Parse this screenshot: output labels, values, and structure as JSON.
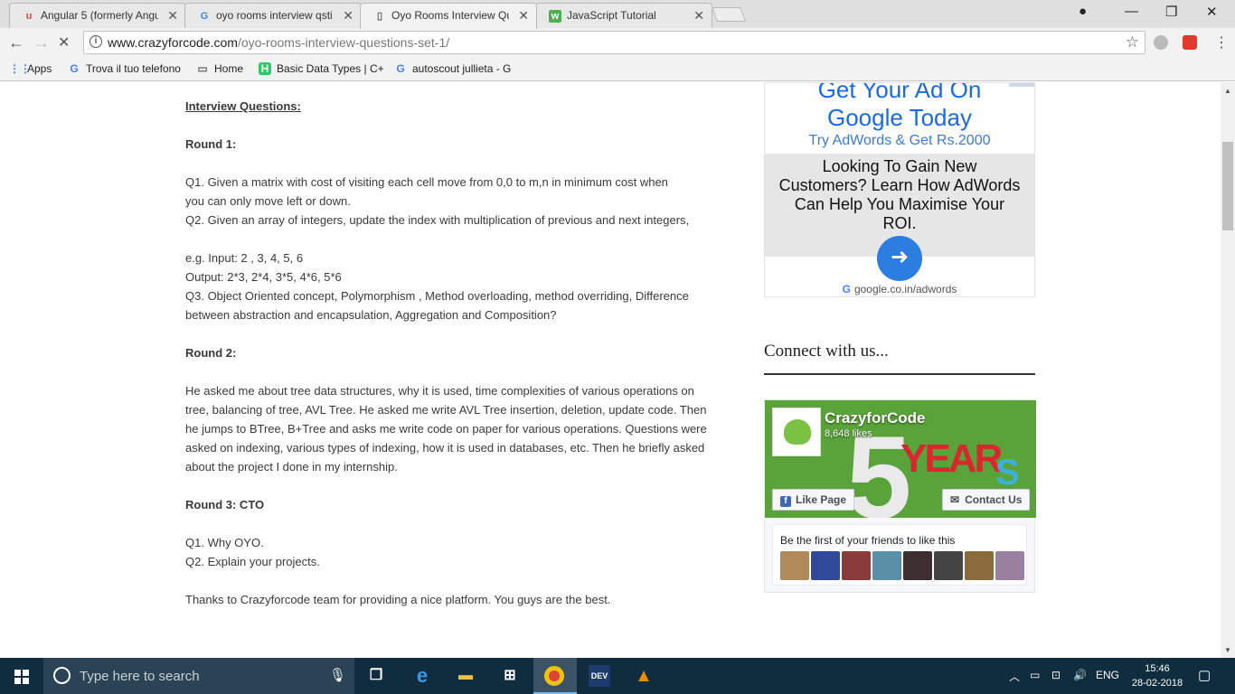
{
  "browser": {
    "tabs": [
      {
        "title": "Angular 5 (formerly Angu",
        "icon": "udemy-icon",
        "color": "#e0493f"
      },
      {
        "title": "oyo rooms interview qsti",
        "icon": "google-icon",
        "color": "#4285f4"
      },
      {
        "title": "Oyo Rooms Interview Qu",
        "icon": "page-icon",
        "color": "#666666"
      },
      {
        "title": "JavaScript Tutorial",
        "icon": "w3schools-icon",
        "color": "#4caf50"
      }
    ],
    "url_host": "www.crazyforcode.com",
    "url_path": "/oyo-rooms-interview-questions-set-1/",
    "bookmarks": [
      {
        "label": "Apps",
        "icon": "apps-grid-icon"
      },
      {
        "label": "Trova il tuo telefono",
        "icon": "google-icon"
      },
      {
        "label": "Home",
        "icon": "page-icon"
      },
      {
        "label": "Basic Data Types | C+",
        "icon": "hackerrank-icon"
      },
      {
        "label": "autoscout jullieta - G",
        "icon": "google-icon"
      }
    ]
  },
  "article": {
    "heading": "Interview Questions:",
    "round1_title": "Round 1:",
    "r1_q1_line1": "Q1. Given a matrix with cost of visiting each cell move from 0,0 to m,n in minimum cost when",
    "r1_q1_line2": "you can only move left or down.",
    "r1_q2": "Q2. Given an array of integers, update the index with multiplication of previous and next integers,",
    "r1_eg_input": "e.g. Input: 2 , 3, 4, 5, 6",
    "r1_eg_output": "Output: 2*3, 2*4, 3*5, 4*6, 5*6",
    "r1_q3_line1": "Q3. Object Oriented concept, Polymorphism , Method overloading, method overriding, Difference",
    "r1_q3_line2": "between abstraction and encapsulation, Aggregation and Composition?",
    "round2_title": "Round 2:",
    "r2_lines": [
      "He asked me about tree data structures, why it is used, time complexities of various operations on",
      "tree, balancing of tree, AVL Tree. He asked me write AVL Tree insertion, deletion, update code. Then",
      "he jumps to BTree, B+Tree and asks me write code on paper for various operations. Questions were",
      "asked on indexing, various types of indexing, how it is used in databases, etc. Then he briefly asked",
      "about the project I done in my internship."
    ],
    "round3_title": "Round 3: CTO",
    "r3_q1": "Q1. Why OYO.",
    "r3_q2": "Q2. Explain your projects.",
    "thanks": "Thanks to Crazyforcode team for providing a nice platform. You guys are the best."
  },
  "ad": {
    "headline_1": "Get Your Ad On",
    "headline_2": "Google Today",
    "subhead": "Try AdWords & Get Rs.2000",
    "body_lines": [
      "Looking To Gain New",
      "Customers? Learn How AdWords",
      "Can Help You Maximise Your",
      "ROI."
    ],
    "display_url": "google.co.in/adwords"
  },
  "sidebar": {
    "connect_title": "Connect with us..."
  },
  "facebook": {
    "page_name": "CrazyforCode",
    "likes": "8,648 likes",
    "cover_text": "5 YEARS",
    "like_button": "Like Page",
    "contact_button": "Contact Us",
    "friends_text": "Be the first of your friends to like this",
    "face_colors": [
      "#b08a5a",
      "#2f4a9a",
      "#8a3b3b",
      "#5a8fa8",
      "#3d2f2f",
      "#444444",
      "#8a6b3b",
      "#9a7fa0"
    ]
  },
  "taskbar": {
    "search_placeholder": "Type here to search",
    "language": "ENG",
    "time": "15:46",
    "date": "28-02-2018"
  }
}
